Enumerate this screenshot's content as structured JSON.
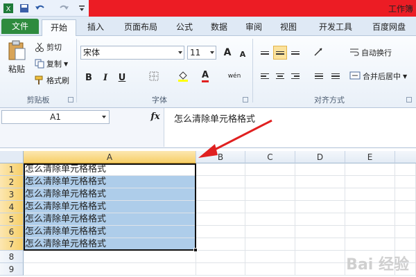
{
  "title_bar": {
    "doc_title": "工作簿"
  },
  "tabs": [
    "文件",
    "开始",
    "插入",
    "页面布局",
    "公式",
    "数据",
    "审阅",
    "视图",
    "开发工具",
    "百度网盘"
  ],
  "clipboard": {
    "paste": "粘贴",
    "cut": "剪切",
    "copy": "复制",
    "format_painter": "格式刷",
    "group": "剪贴板"
  },
  "font": {
    "name": "宋体",
    "size": "11",
    "group": "字体",
    "bold": "B",
    "italic": "I",
    "underline": "U",
    "grow": "A",
    "shrink": "A",
    "color_a": "A",
    "pinyin": "wén"
  },
  "alignment": {
    "wrap": "自动换行",
    "merge": "合并后居中",
    "group": "对齐方式"
  },
  "formula_bar": {
    "name_box": "A1",
    "fx": "fx",
    "content": "怎么清除单元格格式"
  },
  "columns": [
    "A",
    "B",
    "C",
    "D",
    "E"
  ],
  "rows": [
    "1",
    "2",
    "3",
    "4",
    "5",
    "6",
    "7",
    "8",
    "9"
  ],
  "cells_col_a": [
    "怎么清除单元格格式",
    "怎么清除单元格格式",
    "怎么清除单元格格式",
    "怎么清除单元格格式",
    "怎么清除单元格格式",
    "怎么清除单元格格式",
    "怎么清除单元格格式",
    "",
    ""
  ],
  "watermark": "Bai 经验",
  "colors": {
    "file_tab": "#2e8b3e",
    "selection": "#aecdea",
    "header_selected": "#f7cf68",
    "arrow": "#e02020",
    "title_red": "#ec1c24"
  }
}
